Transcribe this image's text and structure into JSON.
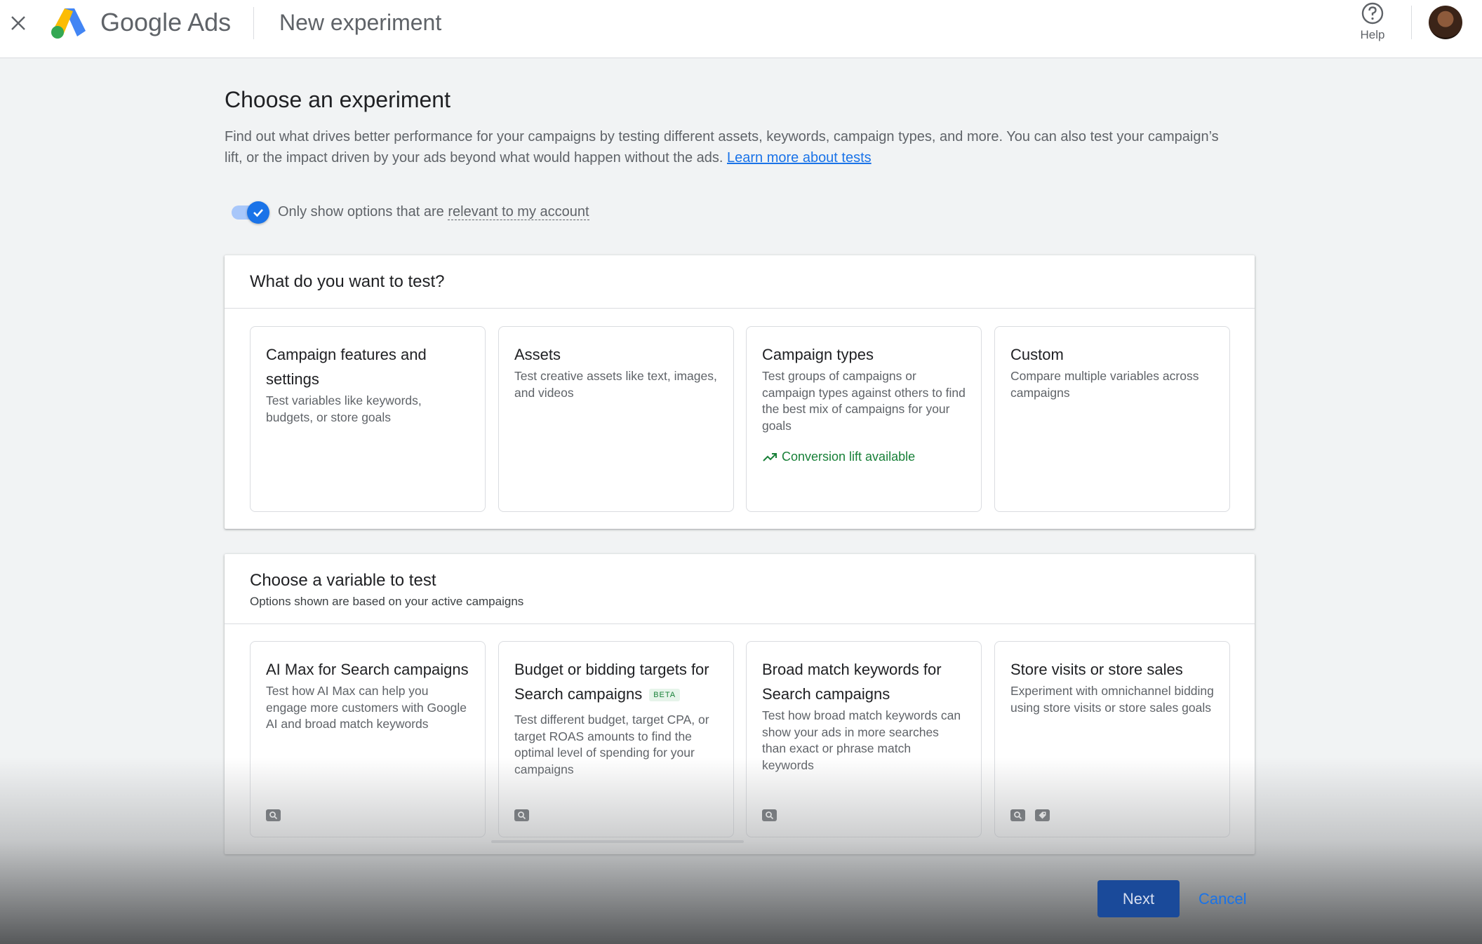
{
  "header": {
    "close_icon": "close-icon",
    "brand_google": "Google",
    "brand_ads": "Ads",
    "page_name": "New experiment",
    "help_label": "Help"
  },
  "main": {
    "title": "Choose an experiment",
    "intro": "Find out what drives better performance for your campaigns by testing different assets, keywords, campaign types, and more. You can also test your campaign’s lift, or the impact driven by your ads beyond what would happen without the ads.",
    "learn_more": "Learn more about tests",
    "toggle_label_prefix": "Only show options that are ",
    "toggle_label_link": "relevant to my account",
    "toggle_on": true
  },
  "test_panel": {
    "title": "What do you want to test?",
    "cards": [
      {
        "title": "Campaign features and settings",
        "desc": "Test variables like keywords, budgets, or store goals"
      },
      {
        "title": "Assets",
        "desc": "Test creative assets like text, images, and videos"
      },
      {
        "title": "Campaign types",
        "desc": "Test groups of campaigns or campaign types against others to find the best mix of campaigns for your goals",
        "extra": "Conversion lift available"
      },
      {
        "title": "Custom",
        "desc": "Compare multiple variables across campaigns"
      }
    ]
  },
  "variable_panel": {
    "title": "Choose a variable to test",
    "subtitle": "Options shown are based on your active campaigns",
    "cards": [
      {
        "title": "AI Max for Search campaigns",
        "desc": "Test how AI Max can help you engage more customers with Google AI and broad match keywords"
      },
      {
        "title": "Budget or bidding targets for Search campaigns",
        "badge": "BETA",
        "desc": "Test different budget, target CPA, or target ROAS amounts to find the optimal level of spending for your campaigns"
      },
      {
        "title": "Broad match keywords for Search campaigns",
        "desc": "Test how broad match keywords can show your ads in more searches than exact or phrase match keywords"
      },
      {
        "title": "Store visits or store sales",
        "desc": "Experiment with omnichannel bidding using store visits or store sales goals"
      }
    ]
  },
  "footer": {
    "next_label": "Next",
    "cancel_label": "Cancel"
  },
  "colors": {
    "accent": "#1a73e8",
    "success": "#188038",
    "text_primary": "#202124",
    "text_secondary": "#5f6368"
  }
}
